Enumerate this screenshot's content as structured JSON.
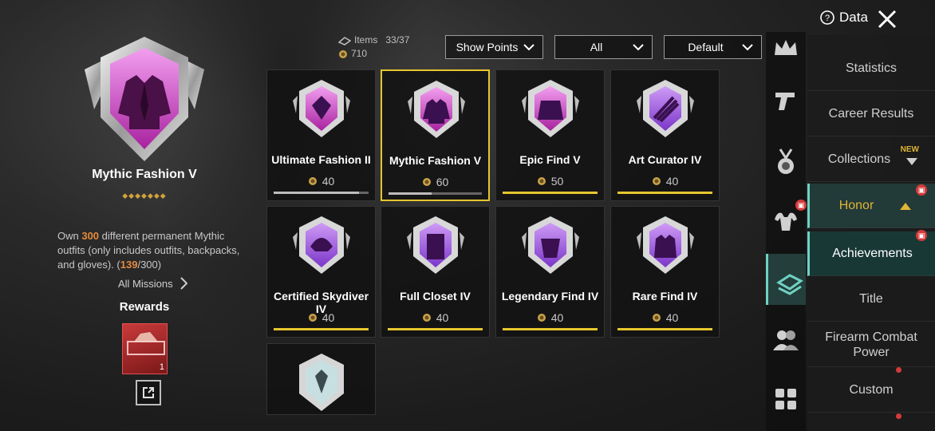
{
  "featured": {
    "title": "Mythic Fashion V",
    "stars": "◆◆◆◆◆◆◆",
    "description_parts": {
      "prefix": "Own ",
      "target": "300",
      "middle": " different permanent Mythic outfits (only includes outfits, backpacks, and gloves). (",
      "current": "139",
      "suffix": "/300)"
    },
    "all_missions_label": "All Missions",
    "rewards_label": "Rewards",
    "reward_count": "1"
  },
  "summary": {
    "items_label": "Items",
    "items_value": "33/37",
    "points_value": "710"
  },
  "filters": {
    "points": "Show Points",
    "category": "All",
    "sort": "Default"
  },
  "header": {
    "data_label": "Data"
  },
  "cards": [
    {
      "name": "Ultimate Fashion II",
      "points": "40",
      "progress": 0.9
    },
    {
      "name": "Mythic Fashion V",
      "points": "60",
      "progress": 0.46
    },
    {
      "name": "Epic Find V",
      "points": "50",
      "progress": 1.0
    },
    {
      "name": "Art Curator IV",
      "points": "40",
      "progress": 1.0
    },
    {
      "name": "Certified Skydiver IV",
      "points": "40",
      "progress": 1.0
    },
    {
      "name": "Full Closet IV",
      "points": "40",
      "progress": 1.0
    },
    {
      "name": "Legendary Find IV",
      "points": "40",
      "progress": 1.0
    },
    {
      "name": "Rare Find IV",
      "points": "40",
      "progress": 1.0
    }
  ],
  "menu": {
    "statistics": "Statistics",
    "career": "Career Results",
    "collections": "Collections",
    "new_badge": "NEW",
    "honor": "Honor",
    "achievements": "Achievements",
    "title": "Title",
    "firearm": "Firearm Combat Power",
    "custom": "Custom"
  },
  "colors": {
    "accent_gold": "#e6c62d",
    "accent_teal": "#6fd2c3",
    "highlight_orange": "#e58a3c",
    "badge_pink": "#d34fd0",
    "badge_purple": "#a35be0"
  }
}
